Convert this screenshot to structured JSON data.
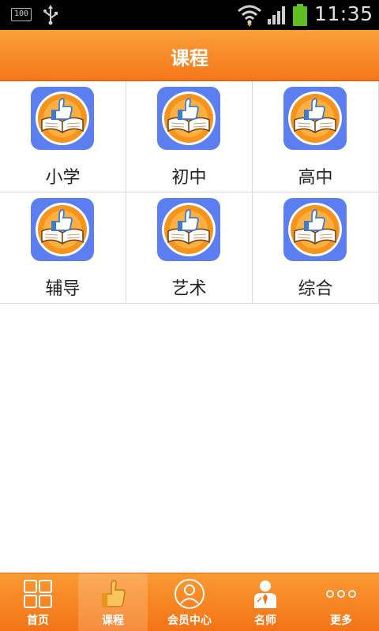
{
  "status_bar": {
    "battery_percent": "100",
    "time": "11:35",
    "icons": [
      "usb-icon",
      "wifi-icon",
      "signal-icon",
      "battery-icon"
    ]
  },
  "header": {
    "title": "课程"
  },
  "categories": [
    {
      "label": "小学",
      "icon": "thumbs-up-book-icon"
    },
    {
      "label": "初中",
      "icon": "thumbs-up-book-icon"
    },
    {
      "label": "高中",
      "icon": "thumbs-up-book-icon"
    },
    {
      "label": "辅导",
      "icon": "thumbs-up-book-icon"
    },
    {
      "label": "艺术",
      "icon": "thumbs-up-book-icon"
    },
    {
      "label": "综合",
      "icon": "thumbs-up-book-icon"
    }
  ],
  "tabs": [
    {
      "label": "首页",
      "icon": "grid-icon"
    },
    {
      "label": "课程",
      "icon": "thumbs-up-icon",
      "active": true
    },
    {
      "label": "会员中心",
      "icon": "user-icon"
    },
    {
      "label": "名师",
      "icon": "teacher-icon"
    },
    {
      "label": "更多",
      "icon": "more-icon"
    }
  ],
  "colors": {
    "accent_orange": "#f5781a",
    "icon_blue": "#5b7ff0",
    "icon_orange": "#f7941d",
    "divider": "#d9d9d9"
  }
}
